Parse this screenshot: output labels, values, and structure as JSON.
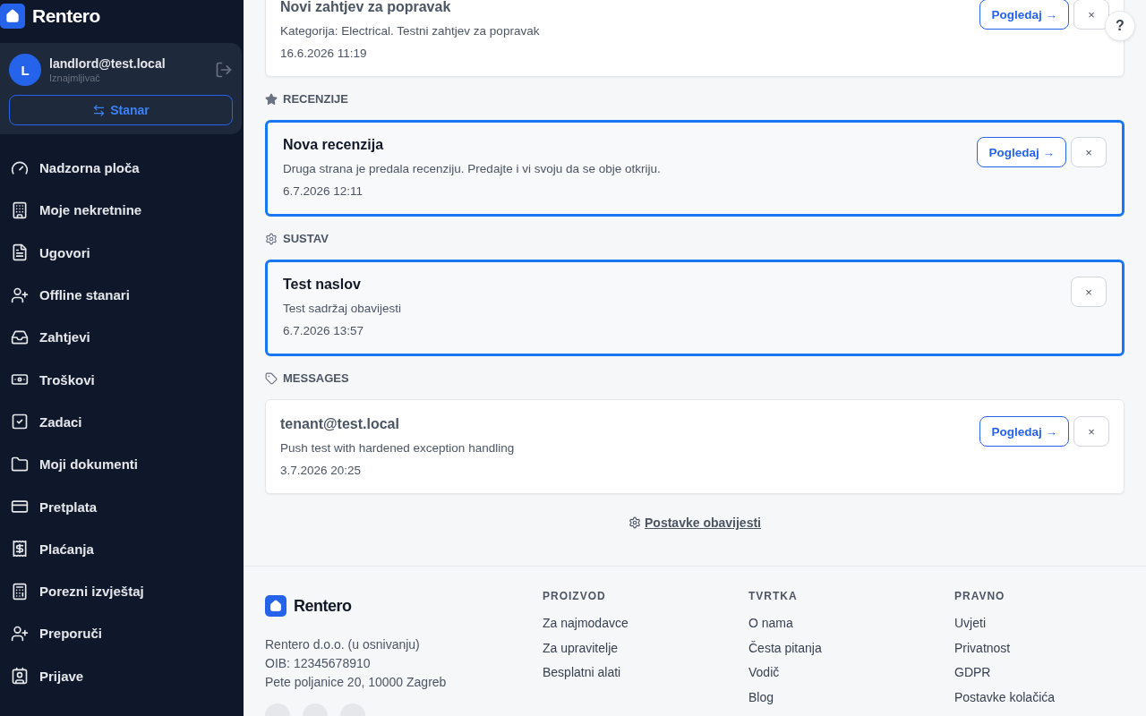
{
  "sidebar": {
    "brand": "Rentero",
    "user": {
      "initial": "L",
      "email": "landlord@test.local",
      "role": "Iznajmljivač",
      "switch_label": "Stanar"
    },
    "items": [
      {
        "label": "Nadzorna ploča",
        "selected": false
      },
      {
        "label": "Moje nekretnine",
        "selected": false
      },
      {
        "label": "Ugovori",
        "selected": false
      },
      {
        "label": "Offline stanari",
        "selected": false
      },
      {
        "label": "Zahtjevi",
        "selected": false
      },
      {
        "label": "Troškovi",
        "selected": false
      },
      {
        "label": "Zadaci",
        "selected": false
      },
      {
        "label": "Moji dokumenti",
        "selected": false
      },
      {
        "label": "Pretplata",
        "selected": false
      },
      {
        "label": "Plaćanja",
        "selected": false
      },
      {
        "label": "Porezni izvještaj",
        "selected": false
      },
      {
        "label": "Preporuči",
        "selected": false
      },
      {
        "label": "Prijave",
        "selected": false
      }
    ]
  },
  "help_button": "?",
  "sections": [
    {
      "kind": "none",
      "notifications": [
        {
          "title": "Novi zahtjev za popravak",
          "body": "Kategorija: Electrical. Testni zahtjev za popravak",
          "time": "16.6.2026 11:19",
          "unread": false,
          "view_label": "Pogledaj →",
          "dismiss": "×"
        }
      ]
    },
    {
      "heading": "RECENZIJE",
      "kind": "star",
      "notifications": [
        {
          "title": "Nova recenzija",
          "body": "Druga strana je predala recenziju. Predajte i vi svoju da se obje otkriju.",
          "time": "6.7.2026 12:11",
          "unread": true,
          "view_label": "Pogledaj →",
          "dismiss": "×"
        }
      ]
    },
    {
      "heading": "SUSTAV",
      "kind": "gear",
      "notifications": [
        {
          "title": "Test naslov",
          "body": "Test sadržaj obavijesti",
          "time": "6.7.2026 13:57",
          "unread": true,
          "dismiss": "×"
        }
      ]
    },
    {
      "heading": "MESSAGES",
      "kind": "tag",
      "notifications": [
        {
          "title": "tenant@test.local",
          "body": "Push test with hardened exception handling",
          "time": "3.7.2026 20:25",
          "unread": false,
          "view_label": "Pogledaj →",
          "dismiss": "×"
        }
      ]
    }
  ],
  "settings_link": "Postavke obavijesti",
  "footer": {
    "brand": "Rentero",
    "address": [
      "Rentero d.o.o. (u osnivanju)",
      "OIB: 12345678910",
      "Pete poljanice 20, 10000 Zagreb"
    ],
    "columns": [
      {
        "heading": "PROIZVOD",
        "links": [
          "Za najmodavce",
          "Za upravitelje",
          "Besplatni alati"
        ]
      },
      {
        "heading": "TVRTKA",
        "links": [
          "O nama",
          "Česta pitanja",
          "Vodič",
          "Blog"
        ]
      },
      {
        "heading": "PRAVNO",
        "links": [
          "Uvjeti",
          "Privatnost",
          "GDPR",
          "Postavke kolačića"
        ]
      }
    ]
  }
}
